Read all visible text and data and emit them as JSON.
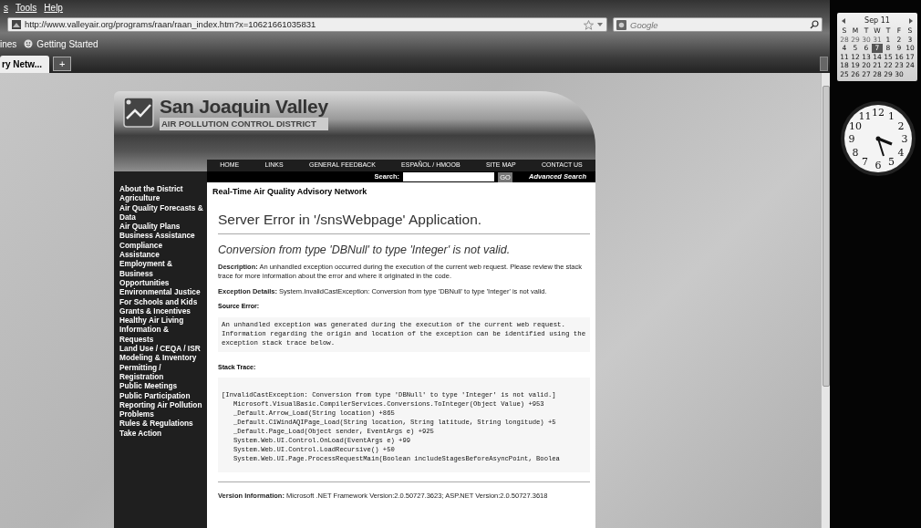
{
  "browser": {
    "menu": [
      "s",
      "Tools",
      "Help"
    ],
    "address": "http://www.valleyair.org/programs/raan/raan_index.htm?x=10621661035831",
    "search": {
      "placeholder": "Google"
    },
    "bookmarks": [
      "ines",
      "Getting Started"
    ],
    "tabs": [
      {
        "label": "ry Netw...",
        "selected": true
      }
    ],
    "new_tab": "+"
  },
  "site": {
    "title": "San Joaquin Valley",
    "subtitle": "AIR POLLUTION CONTROL DISTRICT",
    "nav": [
      "HOME",
      "LINKS",
      "GENERAL FEEDBACK",
      "ESPAÑOL / HMOOB",
      "SITE MAP",
      "CONTACT US"
    ],
    "search": {
      "label": "Search:",
      "button": "GO",
      "advanced": "Advanced Search"
    },
    "sidebar": [
      "About the District",
      "Agriculture",
      "Air Quality Forecasts & Data",
      "Air Quality Plans",
      "Business Assistance",
      "Compliance Assistance",
      "Employment & Business Opportunities",
      "Environmental Justice",
      "For Schools and Kids",
      "Grants & Incentives",
      "Healthy Air Living",
      "Information & Requests",
      "Land Use / CEQA / ISR",
      "Modeling & Inventory",
      "Permitting / Registration",
      "Public Meetings",
      "Public Participation",
      "Reporting Air Pollution Problems",
      "Rules & Regulations",
      "Take Action"
    ],
    "page_title": "Real-Time Air Quality Advisory Network",
    "error": {
      "heading": "Server Error in '/snsWebpage' Application.",
      "message": "Conversion from type 'DBNull' to type 'Integer' is not valid.",
      "description": "**Description:** An unhandled exception occurred during the execution of the current web request. Please review the stack trace for more information about the error and where it originated in the code.",
      "details": "**Exception Details:** System.InvalidCastException: Conversion from type 'DBNull' to type 'Integer' is not valid.",
      "source_label": "Source Error:",
      "source_text": "An unhandled exception was generated during the execution of the current web request. Information regarding the origin and location of the exception can be identified using the exception stack trace below.",
      "stack_label": "Stack Trace:",
      "stack": [
        "[InvalidCastException: Conversion from type 'DBNull' to type 'Integer' is not valid.]",
        "   Microsoft.VisualBasic.CompilerServices.Conversions.ToInteger(Object Value) +953",
        "   _Default.Arrow_Load(String location) +865",
        "   _Default.C1WindAQIPage_Load(String location, String latitude, String longitude) +5",
        "   _Default.Page_Load(Object sender, EventArgs e) +925",
        "   System.Web.UI.Control.OnLoad(EventArgs e) +99",
        "   System.Web.UI.Control.LoadRecursive() +50",
        "   System.Web.UI.Page.ProcessRequestMain(Boolean includeStagesBeforeAsyncPoint, Boolea"
      ],
      "version": "**Version Information:** Microsoft .NET Framework Version:2.0.50727.3623; ASP.NET Version:2.0.50727.3618"
    }
  },
  "gadgets": {
    "calendar": {
      "month": "Sep 11",
      "weekdays": [
        "S",
        "M",
        "T",
        "W",
        "T",
        "F",
        "S"
      ],
      "weeks": [
        [
          {
            "day": "28",
            "other_month": true,
            "selected": false
          },
          {
            "day": "29",
            "other_month": true,
            "selected": false
          },
          {
            "day": "30",
            "other_month": true,
            "selected": false
          },
          {
            "day": "31",
            "other_month": true,
            "selected": false
          },
          {
            "day": "1",
            "other_month": false,
            "selected": false
          },
          {
            "day": "2",
            "other_month": false,
            "selected": false
          },
          {
            "day": "3",
            "other_month": false,
            "selected": false
          }
        ],
        [
          {
            "day": "4",
            "other_month": false,
            "selected": false
          },
          {
            "day": "5",
            "other_month": false,
            "selected": false
          },
          {
            "day": "6",
            "other_month": false,
            "selected": false
          },
          {
            "day": "7",
            "other_month": false,
            "selected": true
          },
          {
            "day": "8",
            "other_month": false,
            "selected": false
          },
          {
            "day": "9",
            "other_month": false,
            "selected": false
          },
          {
            "day": "10",
            "other_month": false,
            "selected": false
          }
        ],
        [
          {
            "day": "11",
            "other_month": false,
            "selected": false
          },
          {
            "day": "12",
            "other_month": false,
            "selected": false
          },
          {
            "day": "13",
            "other_month": false,
            "selected": false
          },
          {
            "day": "14",
            "other_month": false,
            "selected": false
          },
          {
            "day": "15",
            "other_month": false,
            "selected": false
          },
          {
            "day": "16",
            "other_month": false,
            "selected": false
          },
          {
            "day": "17",
            "other_month": false,
            "selected": false
          }
        ],
        [
          {
            "day": "18",
            "other_month": false,
            "selected": false
          },
          {
            "day": "19",
            "other_month": false,
            "selected": false
          },
          {
            "day": "20",
            "other_month": false,
            "selected": false
          },
          {
            "day": "21",
            "other_month": false,
            "selected": false
          },
          {
            "day": "22",
            "other_month": false,
            "selected": false
          },
          {
            "day": "23",
            "other_month": false,
            "selected": false
          },
          {
            "day": "24",
            "other_month": false,
            "selected": false
          }
        ],
        [
          {
            "day": "25",
            "other_month": false,
            "selected": false
          },
          {
            "day": "26",
            "other_month": false,
            "selected": false
          },
          {
            "day": "27",
            "other_month": false,
            "selected": false
          },
          {
            "day": "28",
            "other_month": false,
            "selected": false
          },
          {
            "day": "29",
            "other_month": false,
            "selected": false
          },
          {
            "day": "30",
            "other_month": false,
            "selected": false
          }
        ]
      ]
    },
    "clock": {
      "numerals": [
        "11",
        "12",
        "1",
        "10",
        "2",
        "9",
        "3",
        "8",
        "4",
        "7",
        "5",
        "6"
      ]
    }
  }
}
